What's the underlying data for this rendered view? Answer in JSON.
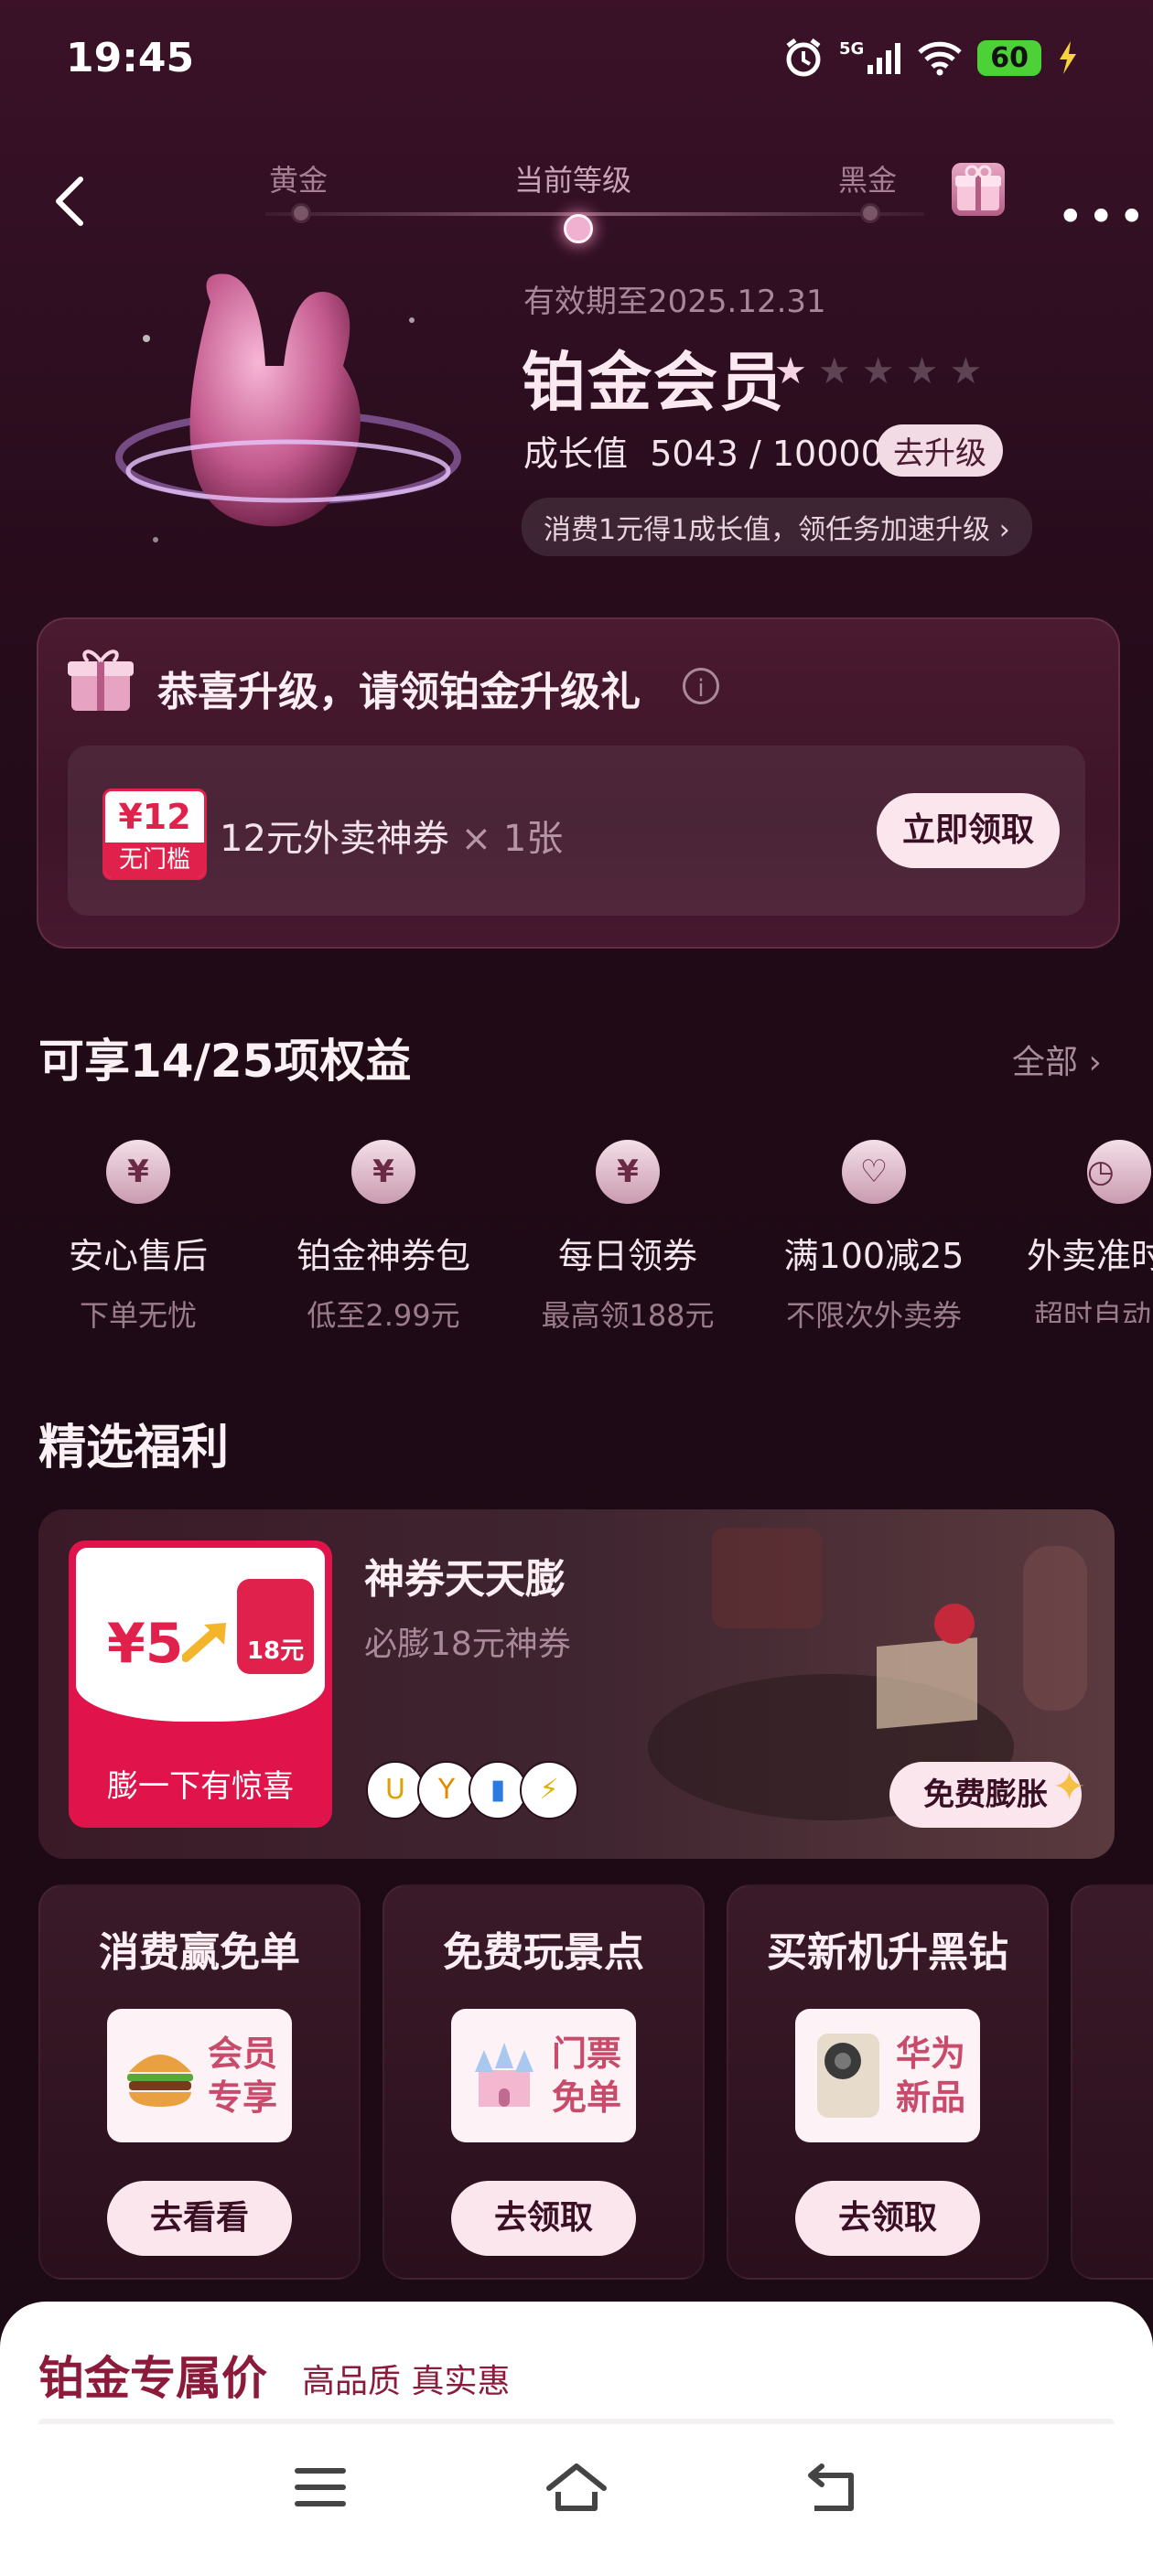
{
  "status_bar": {
    "time": "19:45",
    "network": "5G",
    "battery": "60"
  },
  "header": {
    "tiers": [
      {
        "label": "黄金",
        "current": false
      },
      {
        "label": "当前等级",
        "current": true
      },
      {
        "label": "黑金",
        "current": false
      }
    ]
  },
  "membership": {
    "validity": "有效期至2025.12.31",
    "level": "铂金会员",
    "stars_total": 5,
    "stars_filled": 1,
    "growth_label": "成长值",
    "growth_value": "5043 / 10000",
    "upgrade_button": "去升级",
    "tip": "消费1元得1成长值，领任务加速升级"
  },
  "upgrade_gift": {
    "title": "恭喜升级，请领铂金升级礼",
    "coupon_amount": "¥12",
    "coupon_tag": "无门槛",
    "coupon_name": "12元外卖神券",
    "coupon_count": "1张",
    "claim_button": "立即领取"
  },
  "rights": {
    "title": "可享14/25项权益",
    "all_label": "全部",
    "items": [
      {
        "name": "安心售后",
        "sub": "下单无忧",
        "icon": "¥"
      },
      {
        "name": "铂金神券包",
        "sub": "低至2.99元",
        "icon": "¥"
      },
      {
        "name": "每日领券",
        "sub": "最高领188元",
        "icon": "¥"
      },
      {
        "name": "满100减25",
        "sub": "不限次外卖券",
        "icon": "♡"
      },
      {
        "name": "外卖准时",
        "sub": "超时自动",
        "icon": "◷"
      }
    ]
  },
  "selected": {
    "title": "精选福利",
    "swell": {
      "badge_amount": "¥5",
      "badge_target": "18元",
      "badge_bottom": "膨一下有惊喜",
      "title": "神券天天膨",
      "subtitle": "必膨18元神券",
      "button": "免费膨胀",
      "icons": [
        "U",
        "Y",
        "▮",
        "⚡"
      ]
    },
    "cards": [
      {
        "title": "消费赢免单",
        "tag_line1": "会员",
        "tag_line2": "专享",
        "button": "去看看"
      },
      {
        "title": "免费玩景点",
        "tag_line1": "门票",
        "tag_line2": "免单",
        "button": "去领取"
      },
      {
        "title": "买新机升黑钻",
        "tag_line1": "华为",
        "tag_line2": "新品",
        "button": "去领取"
      }
    ]
  },
  "exclusive": {
    "title": "铂金专属价",
    "subtitle": "高品质 真实惠"
  },
  "colors": {
    "accent": "#e0214b",
    "brand_dark": "#8b1a3b",
    "button_bg": "#fbe6ee"
  },
  "icons": [
    "back-icon",
    "gift-icon",
    "more-icon",
    "alarm-icon",
    "signal-icon",
    "wifi-icon",
    "info-icon",
    "menu-icon",
    "home-icon",
    "return-icon"
  ]
}
